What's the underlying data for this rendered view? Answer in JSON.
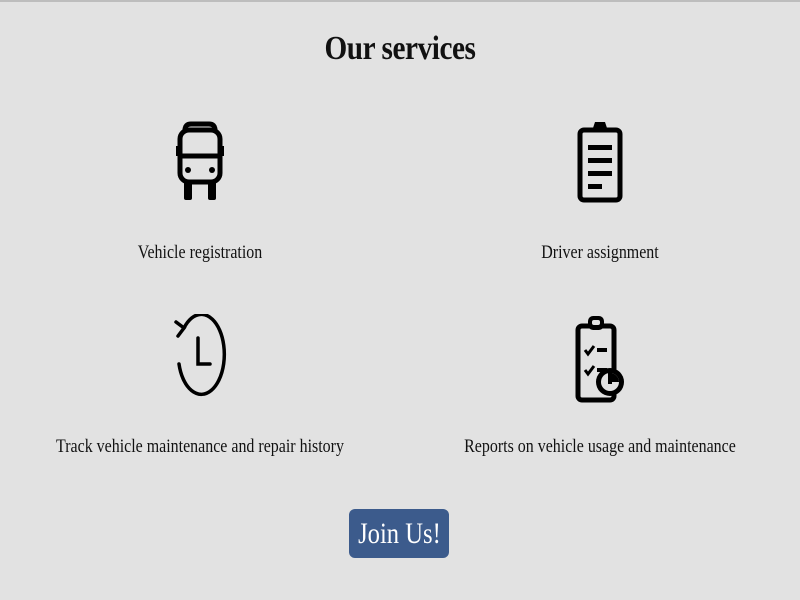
{
  "header": {
    "title": "Our services"
  },
  "services": [
    {
      "label": "Vehicle registration",
      "icon": "bus-icon"
    },
    {
      "label": "Driver assignment",
      "icon": "clipboard-list-icon"
    },
    {
      "label": "Track vehicle maintenance and repair history",
      "icon": "history-clock-icon"
    },
    {
      "label": "Reports on vehicle usage and maintenance",
      "icon": "clipboard-report-icon"
    }
  ],
  "cta": {
    "label": "Join Us!",
    "color": "#3c5b8c"
  },
  "colors": {
    "background": "#e2e2e2",
    "text": "#111111",
    "button_text": "#ffffff"
  }
}
